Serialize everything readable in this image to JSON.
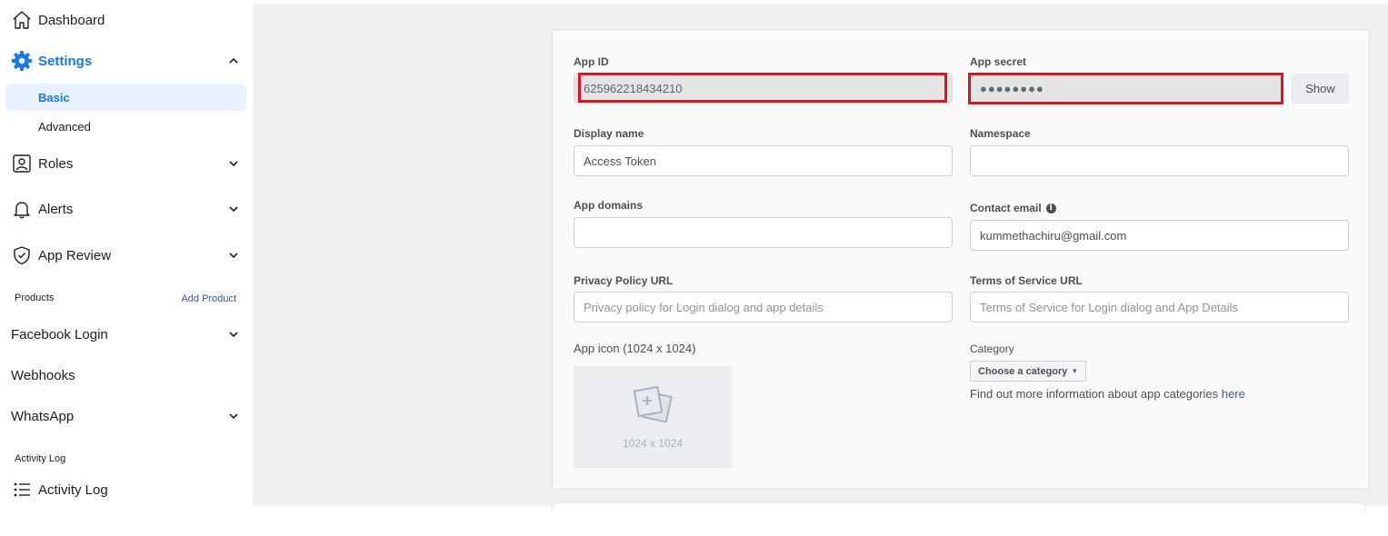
{
  "sidebar": {
    "dashboard": "Dashboard",
    "settings": "Settings",
    "settings_sub": [
      "Basic",
      "Advanced"
    ],
    "roles": "Roles",
    "alerts": "Alerts",
    "app_review": "App Review",
    "products_label": "Products",
    "add_product": "Add Product",
    "facebook_login": "Facebook Login",
    "webhooks": "Webhooks",
    "whatsapp": "WhatsApp",
    "activity_section": "Activity Log",
    "activity_log": "Activity Log"
  },
  "form": {
    "app_id_label": "App ID",
    "app_id_value": "625962218434210",
    "app_secret_label": "App secret",
    "app_secret_value": "●●●●●●●●",
    "show_button": "Show",
    "display_name_label": "Display name",
    "display_name_value": "Access Token",
    "namespace_label": "Namespace",
    "namespace_value": "",
    "app_domains_label": "App domains",
    "app_domains_value": "",
    "contact_email_label": "Contact email",
    "contact_email_value": "kummethachiru@gmail.com",
    "privacy_label": "Privacy Policy URL",
    "privacy_placeholder": "Privacy policy for Login dialog and app details",
    "tos_label": "Terms of Service URL",
    "tos_placeholder": "Terms of Service for Login dialog and App Details",
    "app_icon_label": "App icon (1024 x 1024)",
    "app_icon_dims": "1024 x 1024",
    "category_label": "Category",
    "category_button": "Choose a category",
    "category_help": "Find out more information about app categories ",
    "category_help_link": "here"
  },
  "colors": {
    "accent": "#1877f2",
    "highlight": "#e0141e",
    "main_bg": "#f0f0f0"
  }
}
